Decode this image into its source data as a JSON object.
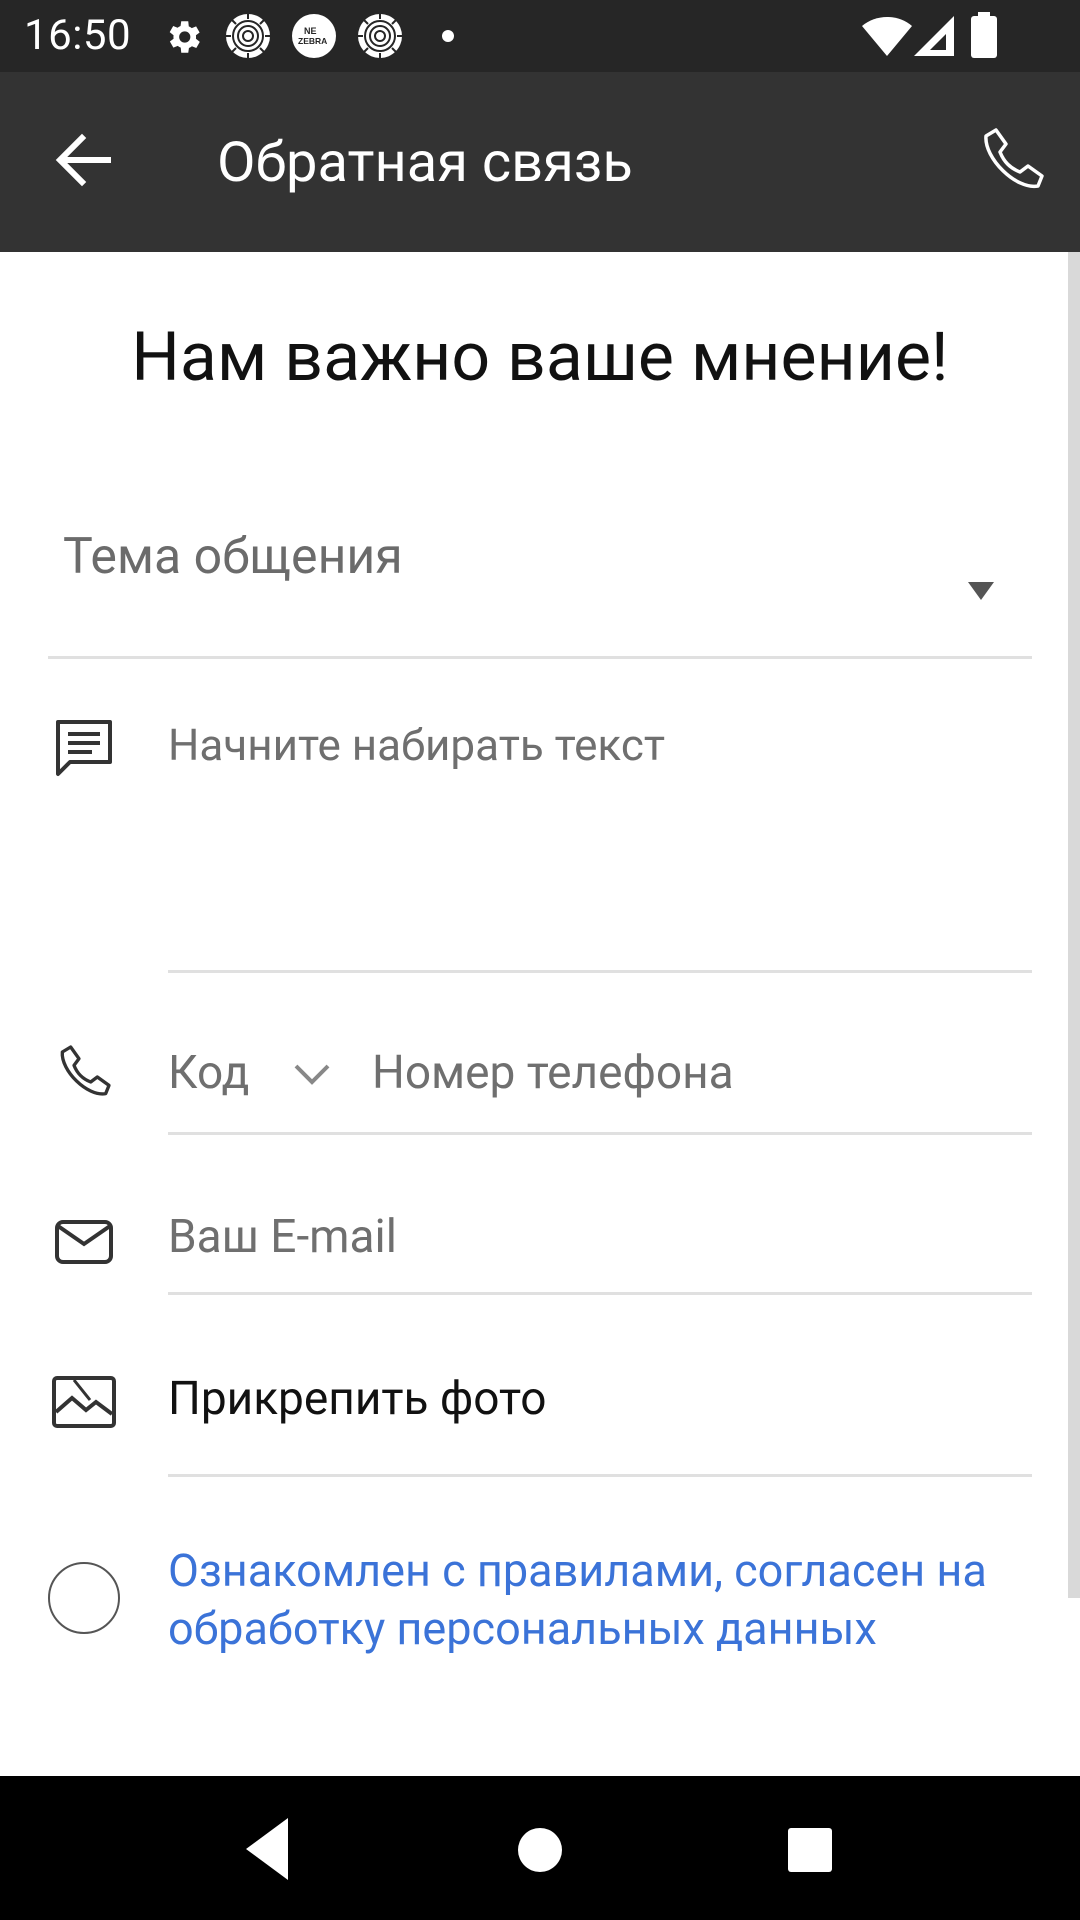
{
  "status_bar": {
    "time": "16:50",
    "notification_icons": [
      "gear-icon",
      "spiral-icon",
      "ne-zebra-icon",
      "spiral-icon",
      "dot-icon"
    ],
    "ne_zebra_text": [
      "NE",
      "ZEBRA"
    ],
    "system_icons": [
      "wifi-icon",
      "signal-icon",
      "battery-icon"
    ]
  },
  "app_bar": {
    "title": "Обратная связь",
    "back_icon": "arrow-back-icon",
    "call_icon": "phone-icon",
    "background": "#333333"
  },
  "form": {
    "heading": "Нам важно ваше мнение!",
    "topic_label": "Тема общения",
    "message_placeholder": "Начните набирать текст",
    "code_label": "Код",
    "phone_placeholder": "Номер телефона",
    "email_placeholder": "Ваш E-mail",
    "attach_photo_label": "Прикрепить фото",
    "consent_text": "Ознакомлен с правилами, согласен на обработку персональных данных",
    "consent_checked": false,
    "accent_color": "#3b73d8"
  },
  "nav_bar": {
    "buttons": [
      "nav-back-icon",
      "nav-home-icon",
      "nav-recents-icon"
    ]
  }
}
